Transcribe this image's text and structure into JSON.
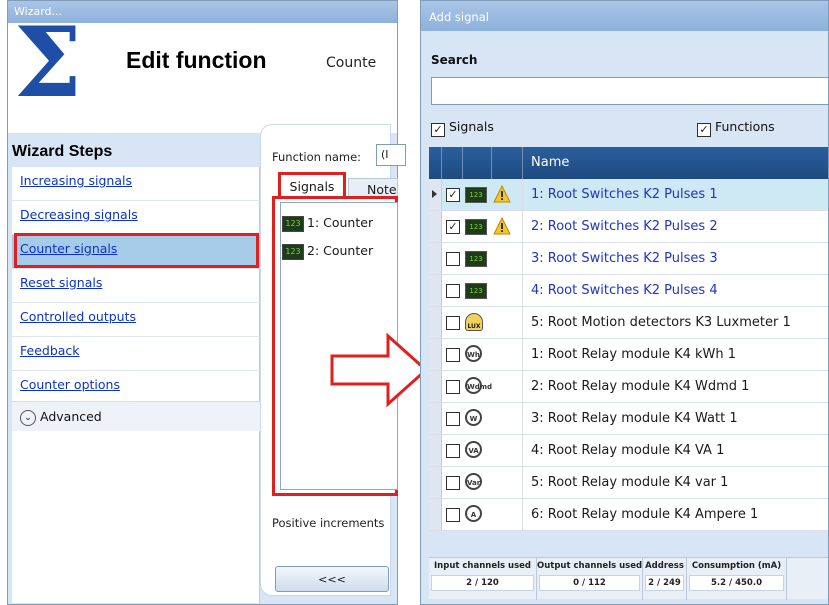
{
  "wizard": {
    "title": "Wizard...",
    "header_title": "Edit function",
    "header_subtitle": "Counte",
    "steps_title": "Wizard Steps",
    "steps": [
      {
        "label": "Increasing signals"
      },
      {
        "label": "Decreasing signals"
      },
      {
        "label": "Counter signals",
        "selected": true
      },
      {
        "label": "Reset signals"
      },
      {
        "label": "Controlled outputs"
      },
      {
        "label": "Feedback"
      },
      {
        "label": "Counter options"
      }
    ],
    "advanced_label": "Advanced",
    "function_name_label": "Function name:",
    "function_name_value": "(I",
    "tabs": [
      {
        "label": "Signals"
      },
      {
        "label": "Note"
      }
    ],
    "signal_list": [
      "1: Counter",
      "2: Counter"
    ],
    "positive_increment_label": "Positive increments",
    "back_button": "<<<"
  },
  "add_signal": {
    "title": "Add signal",
    "search_label": "Search",
    "search_value": "",
    "filters": [
      {
        "label": "Signals",
        "checked": true
      },
      {
        "label": "Functions",
        "checked": true
      }
    ],
    "grid_header": "Name",
    "rows": [
      {
        "name": "1: Root Switches K2 Pulses 1",
        "checked": true,
        "warning": true,
        "selected": true,
        "linked": true,
        "icon": "pulse-counter-icon",
        "badge": "123"
      },
      {
        "name": "2: Root Switches K2 Pulses 2",
        "checked": true,
        "warning": true,
        "selected": false,
        "linked": true,
        "icon": "pulse-counter-icon",
        "badge": "123"
      },
      {
        "name": "3: Root Switches K2 Pulses 3",
        "checked": false,
        "warning": false,
        "selected": false,
        "linked": true,
        "icon": "pulse-counter-icon",
        "badge": "123"
      },
      {
        "name": "4: Root Switches K2 Pulses 4",
        "checked": false,
        "warning": false,
        "selected": false,
        "linked": true,
        "icon": "pulse-counter-icon",
        "badge": "123"
      },
      {
        "name": "5: Root Motion detectors K3 Luxmeter 1",
        "checked": false,
        "warning": false,
        "selected": false,
        "linked": false,
        "icon": "luxmeter-icon",
        "badge": "LUX"
      },
      {
        "name": "1: Root Relay module K4 kWh 1",
        "checked": false,
        "warning": false,
        "selected": false,
        "linked": false,
        "icon": "kwh-icon",
        "badge": "Wh"
      },
      {
        "name": "2: Root Relay module K4 Wdmd 1",
        "checked": false,
        "warning": false,
        "selected": false,
        "linked": false,
        "icon": "wdmd-icon",
        "badge": "Wdmd"
      },
      {
        "name": "3: Root Relay module K4 Watt 1",
        "checked": false,
        "warning": false,
        "selected": false,
        "linked": false,
        "icon": "watt-icon",
        "badge": "W"
      },
      {
        "name": "4: Root Relay module K4 VA 1",
        "checked": false,
        "warning": false,
        "selected": false,
        "linked": false,
        "icon": "va-icon",
        "badge": "VA"
      },
      {
        "name": "5: Root Relay module K4 var 1",
        "checked": false,
        "warning": false,
        "selected": false,
        "linked": false,
        "icon": "var-icon",
        "badge": "Var"
      },
      {
        "name": "6: Root Relay module K4 Ampere 1",
        "checked": false,
        "warning": false,
        "selected": false,
        "linked": false,
        "icon": "ampere-icon",
        "badge": "A"
      }
    ],
    "stats": [
      {
        "label": "Input channels used",
        "value": "2 / 120"
      },
      {
        "label": "Output channels used",
        "value": "0 / 112"
      },
      {
        "label": "Address",
        "value": "2 / 249"
      },
      {
        "label": "Consumption (mA)",
        "value": "5.2 / 450.0"
      }
    ]
  },
  "colors": {
    "highlight_red": "#e0201f",
    "link_blue": "#1d34c7",
    "header_blue": "#1e4a80",
    "selection": "#cfe9f4"
  }
}
